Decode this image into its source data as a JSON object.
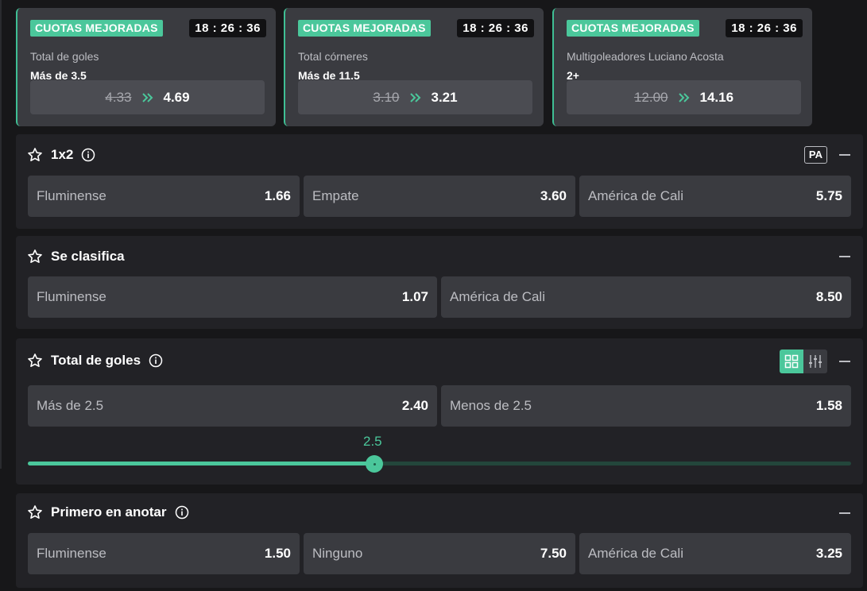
{
  "boosts": [
    {
      "tag": "CUOTAS MEJORADAS",
      "timer": "18 : 26 : 36",
      "market": "Total de goles",
      "selection": "Más de 3.5",
      "old_odd": "4.33",
      "new_odd": "4.69"
    },
    {
      "tag": "CUOTAS MEJORADAS",
      "timer": "18 : 26 : 36",
      "market": "Total córneres",
      "selection": "Más de 11.5",
      "old_odd": "3.10",
      "new_odd": "3.21"
    },
    {
      "tag": "CUOTAS MEJORADAS",
      "timer": "18 : 26 : 36",
      "market": "Multigoleadores Luciano Acosta",
      "selection": "2+",
      "old_odd": "12.00",
      "new_odd": "14.16"
    }
  ],
  "markets": {
    "m1x2": {
      "title": "1x2",
      "badge": "PA",
      "odds": [
        {
          "name": "Fluminense",
          "value": "1.66"
        },
        {
          "name": "Empate",
          "value": "3.60"
        },
        {
          "name": "América de Cali",
          "value": "5.75"
        }
      ]
    },
    "clasifica": {
      "title": "Se clasifica",
      "odds": [
        {
          "name": "Fluminense",
          "value": "1.07"
        },
        {
          "name": "América de Cali",
          "value": "8.50"
        }
      ]
    },
    "goles": {
      "title": "Total de goles",
      "odds": [
        {
          "name": "Más de 2.5",
          "value": "2.40"
        },
        {
          "name": "Menos de 2.5",
          "value": "1.58"
        }
      ],
      "slider": {
        "label": "2.5",
        "position_fraction": 0.421
      }
    },
    "primero": {
      "title": "Primero en anotar",
      "odds": [
        {
          "name": "Fluminense",
          "value": "1.50"
        },
        {
          "name": "Ninguno",
          "value": "7.50"
        },
        {
          "name": "América de Cali",
          "value": "3.25"
        }
      ]
    }
  },
  "icons": {
    "favorite": "star-outline-icon",
    "info": "info-circle-icon",
    "collapse": "minus-icon",
    "boost_arrow": "double-chevron-right-icon",
    "grid_view": "grid-icon",
    "slider_view": "sliders-icon"
  },
  "colors": {
    "accent": "#4bc79b",
    "panel_bg": "#222226",
    "button_bg": "#3a3b40",
    "page_bg": "#171719"
  }
}
